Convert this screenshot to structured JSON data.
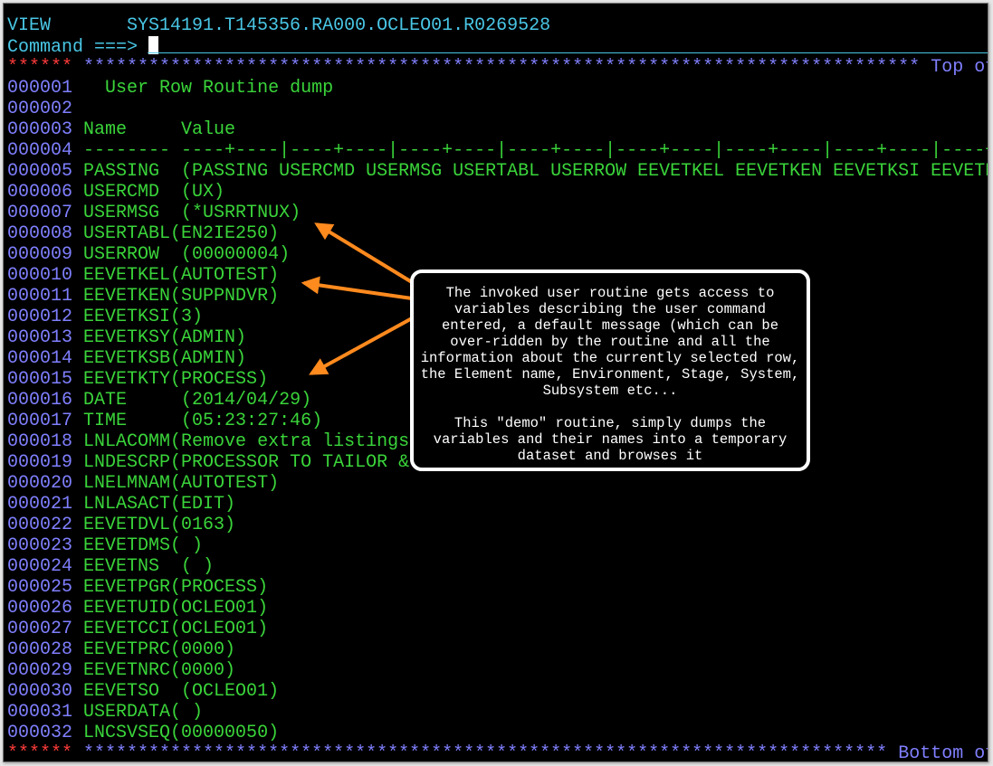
{
  "header": {
    "mode": "VIEW",
    "dataset": "SYS14191.T145356.RA000.OCLEO01.R0269528",
    "command_label": "Command ===>",
    "command_value": ""
  },
  "top_marker": {
    "prefix": "******",
    "stars": "*****************************************************************************",
    "text": "Top of Data **"
  },
  "lines": [
    {
      "num": "000001",
      "text": "  User Row Routine dump"
    },
    {
      "num": "000002",
      "text": ""
    },
    {
      "num": "000003",
      "text": "Name     Value"
    },
    {
      "num": "000004",
      "text": "-------- ----+----|----+----|----+----|----+----|----+----|----+----|----+----|----+----|----"
    },
    {
      "num": "000005",
      "text": "PASSING  (PASSING USERCMD USERMSG USERTABL USERROW EEVETKEL EEVETKEN EEVETKSI EEVETKSY"
    },
    {
      "num": "000006",
      "text": "USERCMD  (UX)"
    },
    {
      "num": "000007",
      "text": "USERMSG  (*USRRTNUX)"
    },
    {
      "num": "000008",
      "text": "USERTABL(EN2IE250)"
    },
    {
      "num": "000009",
      "text": "USERROW  (00000004)"
    },
    {
      "num": "000010",
      "text": "EEVETKEL(AUTOTEST)"
    },
    {
      "num": "000011",
      "text": "EEVETKEN(SUPPNDVR)"
    },
    {
      "num": "000012",
      "text": "EEVETKSI(3)"
    },
    {
      "num": "000013",
      "text": "EEVETKSY(ADMIN)"
    },
    {
      "num": "000014",
      "text": "EEVETKSB(ADMIN)"
    },
    {
      "num": "000015",
      "text": "EEVETKTY(PROCESS)"
    },
    {
      "num": "000016",
      "text": "DATE     (2014/04/29)"
    },
    {
      "num": "000017",
      "text": "TIME     (05:23:27:46)"
    },
    {
      "num": "000018",
      "text": "LNLACOMM(Remove extra listings"
    },
    {
      "num": "000019",
      "text": "LNDESCRP(PROCESSOR TO TAILOR & NDM"
    },
    {
      "num": "000020",
      "text": "LNELMNAM(AUTOTEST)"
    },
    {
      "num": "000021",
      "text": "LNLASACT(EDIT)"
    },
    {
      "num": "000022",
      "text": "EEVETDVL(0163)"
    },
    {
      "num": "000023",
      "text": "EEVETDMS( )"
    },
    {
      "num": "000024",
      "text": "EEVETNS  ( )"
    },
    {
      "num": "000025",
      "text": "EEVETPGR(PROCESS)"
    },
    {
      "num": "000026",
      "text": "EEVETUID(OCLEO01)"
    },
    {
      "num": "000027",
      "text": "EEVETCCI(OCLEO01)"
    },
    {
      "num": "000028",
      "text": "EEVETPRC(0000)"
    },
    {
      "num": "000029",
      "text": "EEVETNRC(0000)"
    },
    {
      "num": "000030",
      "text": "EEVETSO  (OCLEO01)"
    },
    {
      "num": "000031",
      "text": "USERDATA( )"
    },
    {
      "num": "000032",
      "text": "LNCSVSEQ(00000050)"
    }
  ],
  "bottom_marker": {
    "prefix": "******",
    "stars": "**************************************************************************",
    "text": "Bottom of Data"
  },
  "callout": {
    "paragraph1": "The invoked user routine gets access to variables describing the user command entered, a default message (which can be over-ridden by the routine and all the information about the currently selected row, the Element name, Environment, Stage, System, Subsystem etc...",
    "paragraph2": "This \"demo\" routine, simply dumps the variables and their names into a temporary dataset and browses it"
  },
  "colors": {
    "terminal_bg": "#000000",
    "field_cyan": "#49c6e5",
    "data_green": "#3ad43a",
    "line_number_blue": "#7f7fff",
    "marker_red": "#ff3b3b",
    "annotation_orange": "#ff8a1e"
  }
}
